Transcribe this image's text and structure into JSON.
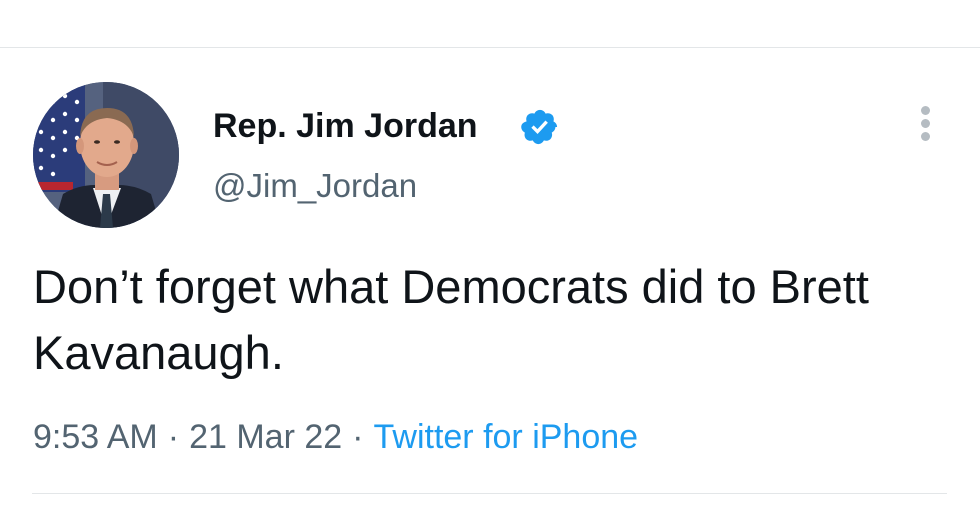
{
  "tweet": {
    "display_name": "Rep. Jim Jordan",
    "handle": "@Jim_Jordan",
    "verified": true,
    "text": "Don’t forget what Democrats did to Brett Kavanaugh.",
    "time": "9:53 AM",
    "separator": "·",
    "date": "21 Mar 22",
    "source": "Twitter for iPhone"
  },
  "icons": {
    "verified": "verified-badge-icon",
    "more": "more-vertical-icon",
    "avatar": "profile-avatar"
  },
  "colors": {
    "text": "#0f1419",
    "secondary": "#536471",
    "link": "#1d9bf0",
    "verified": "#1d9bf0",
    "divider": "#e3e6e8"
  }
}
